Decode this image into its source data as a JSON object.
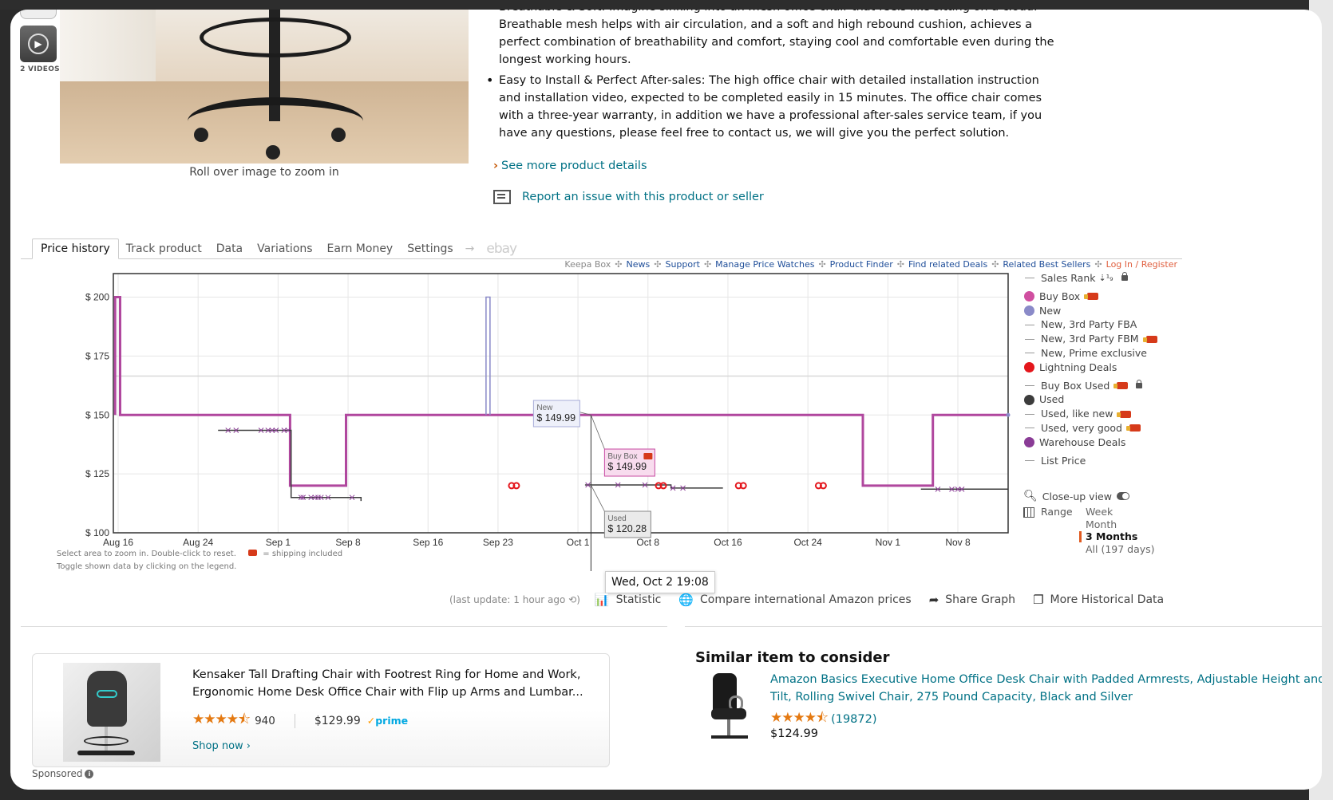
{
  "product": {
    "thumbnails": {
      "video_label": "2 VIDEOS"
    },
    "image_hint": "Roll over image to zoom in",
    "bullets": [
      "Breathable & Soft: Imagine sinking into an mesh office chair that feels like sitting on a cloud. Breathable mesh helps with air circulation, and a soft and high rebound cushion, achieves a perfect combination of breathability and comfort, staying cool and comfortable even during the longest working hours.",
      "Easy to Install & Perfect After-sales: The high office chair with detailed installation instruction and installation video, expected to be completed easily in 15 minutes. The office chair comes with a three-year warranty, in addition we have a professional after-sales service team, if you have any questions, please feel free to contact us, we will give you the perfect solution."
    ],
    "see_more": "See more product details",
    "report_issue": "Report an issue with this product or seller"
  },
  "keepa": {
    "tabs": [
      {
        "label": "Price history",
        "active": true
      },
      {
        "label": "Track product"
      },
      {
        "label": "Data"
      },
      {
        "label": "Variations"
      },
      {
        "label": "Earn Money"
      },
      {
        "label": "Settings"
      }
    ],
    "tab_arrow": "→",
    "tab_ebay": "ebay",
    "links": {
      "keepa_box": "Keepa Box",
      "news": "News",
      "support": "Support",
      "manage": "Manage Price Watches",
      "finder": "Product Finder",
      "deals": "Find related Deals",
      "best": "Related Best Sellers",
      "login": "Log In / Register",
      "sep": "✣"
    },
    "legend": [
      {
        "label": "Sales Rank",
        "type": "line",
        "color": "#999999",
        "extra": "sort-lock"
      },
      {
        "label": "Buy Box",
        "type": "dot",
        "color": "#d04fa0",
        "truck": true
      },
      {
        "label": "New",
        "type": "dot",
        "color": "#8a8ac8"
      },
      {
        "label": "New, 3rd Party FBA",
        "type": "line",
        "color": "#999999"
      },
      {
        "label": "New, 3rd Party FBM",
        "type": "line",
        "color": "#999999",
        "truck": true
      },
      {
        "label": "New, Prime exclusive",
        "type": "line",
        "color": "#999999"
      },
      {
        "label": "Lightning Deals",
        "type": "dot",
        "color": "#e4161c"
      },
      {
        "label": "Buy Box Used",
        "type": "line",
        "color": "#999999",
        "truck": true,
        "lock": true
      },
      {
        "label": "Used",
        "type": "dot",
        "color": "#3c3c3c"
      },
      {
        "label": "Used, like new",
        "type": "line",
        "color": "#999999",
        "truck": true
      },
      {
        "label": "Used, very good",
        "type": "line",
        "color": "#999999",
        "truck": true
      },
      {
        "label": "Warehouse Deals",
        "type": "dot",
        "color": "#8a3c96"
      },
      {
        "label": "List Price",
        "type": "line",
        "color": "#999999"
      }
    ],
    "closeup_label": "Close-up view",
    "range_label": "Range",
    "range_options": [
      {
        "label": "Week"
      },
      {
        "label": "Month"
      },
      {
        "label": "3 Months",
        "active": true
      },
      {
        "label": "All (197 days)"
      }
    ],
    "hint1": "Select area to zoom in. Double-click to reset.",
    "hint1b": "= shipping included",
    "hint2": "Toggle shown data by clicking on the legend.",
    "last_update": "(last update: 1 hour ago ⟲)",
    "actions": [
      {
        "icon": "statistic-icon",
        "glyph": "📊",
        "label": "Statistic"
      },
      {
        "icon": "globe-icon",
        "glyph": "🌐",
        "label": "Compare international Amazon prices"
      },
      {
        "icon": "share-icon",
        "glyph": "➦",
        "label": "Share Graph"
      },
      {
        "icon": "copy-icon",
        "glyph": "❐",
        "label": "More Historical Data"
      }
    ],
    "crosshair_date": "Wed, Oct 2 19:08",
    "tooltips": {
      "new": {
        "label": "New",
        "value": "$ 149.99"
      },
      "buybox": {
        "label": "Buy Box",
        "value": "$ 149.99"
      },
      "used": {
        "label": "Used",
        "value": "$ 120.28"
      }
    }
  },
  "chart_data": {
    "type": "line",
    "title": "",
    "xlabel": "",
    "ylabel": "",
    "ylim": [
      100,
      210
    ],
    "x_unit": "days since Aug 16",
    "xlim": [
      -0.5,
      89
    ],
    "yticks": [
      {
        "v": 100,
        "label": "$ 100"
      },
      {
        "v": 125,
        "label": "$ 125"
      },
      {
        "v": 150,
        "label": "$ 150"
      },
      {
        "v": 175,
        "label": "$ 175"
      },
      {
        "v": 200,
        "label": "$ 200"
      }
    ],
    "xticks": [
      {
        "v": 0,
        "label": "Aug 16"
      },
      {
        "v": 8,
        "label": "Aug 24"
      },
      {
        "v": 16,
        "label": "Sep 1"
      },
      {
        "v": 23,
        "label": "Sep 8"
      },
      {
        "v": 31,
        "label": "Sep 16"
      },
      {
        "v": 38,
        "label": "Sep 23"
      },
      {
        "v": 46,
        "label": "Oct 1"
      },
      {
        "v": 53,
        "label": "Oct 8"
      },
      {
        "v": 61,
        "label": "Oct 16"
      },
      {
        "v": 69,
        "label": "Oct 24"
      },
      {
        "v": 77,
        "label": "Nov 1"
      },
      {
        "v": 84,
        "label": "Nov 8"
      }
    ],
    "grid": true,
    "list_price_line": 166.5,
    "series": [
      {
        "name": "Buy Box",
        "color": "#b0479e",
        "step": true,
        "points": [
          [
            -0.3,
            150
          ],
          [
            -0.3,
            200
          ],
          [
            0.2,
            200
          ],
          [
            0.2,
            150
          ],
          [
            17.2,
            150
          ],
          [
            17.2,
            120
          ],
          [
            22.8,
            120
          ],
          [
            22.8,
            150
          ],
          [
            60.5,
            150
          ],
          [
            74.5,
            150
          ],
          [
            74.5,
            120
          ],
          [
            81.5,
            120
          ],
          [
            81.5,
            150
          ],
          [
            89,
            150
          ]
        ]
      },
      {
        "name": "New",
        "color": "#8a8ac8",
        "step": true,
        "points": [
          [
            36.8,
            150
          ],
          [
            36.8,
            200
          ],
          [
            37.2,
            200
          ],
          [
            37.2,
            150
          ]
        ]
      },
      {
        "name": "Used",
        "color": "#3c3c3c",
        "step": true,
        "points": [
          [
            10,
            143.5
          ],
          [
            17.3,
            143.5
          ],
          [
            17.3,
            115
          ],
          [
            24.3,
            115
          ],
          [
            24.3,
            113.5
          ]
        ]
      },
      {
        "name": "Used (Oct)",
        "color": "#3c3c3c",
        "step": true,
        "points": [
          [
            46.7,
            120.3
          ],
          [
            55.3,
            120.3
          ],
          [
            55.3,
            119
          ],
          [
            60.5,
            119
          ]
        ]
      },
      {
        "name": "Used (Nov)",
        "color": "#3c3c3c",
        "step": true,
        "points": [
          [
            80.3,
            118.5
          ],
          [
            89,
            118.5
          ]
        ]
      }
    ],
    "used_markers": [
      11,
      15,
      15.4,
      15.8,
      17,
      18.3,
      19.3,
      20,
      20.3,
      11.8,
      14.3,
      16.6,
      18.5,
      19.7,
      21,
      23.4,
      47,
      50,
      52.7,
      55.5,
      56.5,
      82,
      83.4,
      84,
      84.4
    ],
    "lightning_markers": [
      [
        39.6,
        120
      ],
      [
        54.3,
        120
      ],
      [
        62.3,
        120
      ],
      [
        70.3,
        120
      ]
    ],
    "crosshair_x": 47.3
  },
  "sponsored": {
    "title": "Kensaker Tall Drafting Chair with Footrest Ring for Home and Work, Ergonomic Home Desk Office Chair with Flip up Arms and Lumbar...",
    "stars": "★★★★⯪",
    "rating": 4.5,
    "review_count": "940",
    "price": "$129.99",
    "prime_check": "✓",
    "prime": "prime",
    "shop_now": "Shop now ›",
    "label": "Sponsored",
    "info": "i"
  },
  "similar": {
    "heading": "Similar item to consider",
    "title": "Amazon Basics Executive Home Office Desk Chair with Padded Armrests, Adjustable Height and Tilt, Rolling Swivel Chair, 275 Pound Capacity, Black and Silver",
    "stars": "★★★★⯪",
    "rating": 4.5,
    "review_count": "(19872)",
    "price": "$124.99"
  }
}
